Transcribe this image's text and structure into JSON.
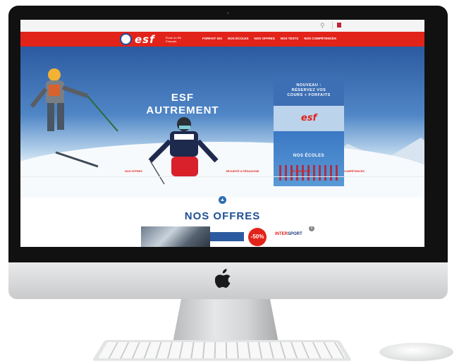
{
  "site": {
    "logo_text": "esf",
    "logo_subtitle": "École du Ski Français",
    "search_icon": "search-icon",
    "nav": [
      "FORFAIT SKI",
      "NOS ÉCOLES",
      "NOS OFFRES",
      "NOS TESTS",
      "NOS COMPÉTENCES"
    ],
    "hero_title_line1": "ESF",
    "hero_title_line2": "AUTREMENT",
    "promo": {
      "line1": "NOUVEAU :",
      "line2": "RÉSERVEZ VOS",
      "line3": "COURS + FORFAITS",
      "brand": "esf"
    },
    "schools_label": "NOS ÉCOLES",
    "hero_links": [
      "NOS OFFRES",
      "NOS ÉCOLES",
      "SÉCURITÉ & PÉDAGOGIE",
      "ÉVÈNEMENTS",
      "COMPÉTENCES"
    ],
    "section_title": "NOS OFFRES",
    "banner": {
      "sale": "-50%",
      "brand_prefix": "INTER",
      "brand_suffix": "SPORT",
      "close": "×"
    }
  },
  "colors": {
    "brand_red": "#e2231a",
    "brand_blue": "#1f4f95"
  },
  "device": {
    "logo_icon": "apple-logo-icon"
  }
}
